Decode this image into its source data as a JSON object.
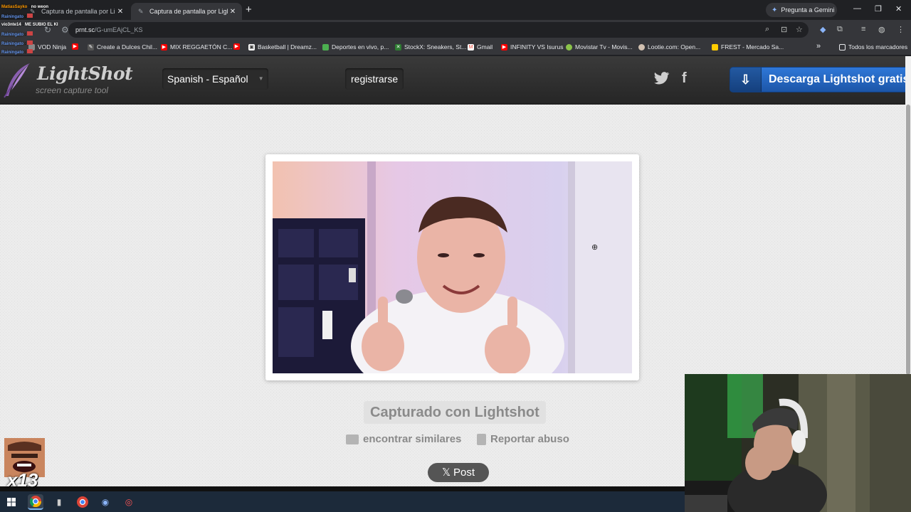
{
  "browser": {
    "tabs": [
      {
        "title": "Captura de pantalla por Lightsh",
        "active": false
      },
      {
        "title": "Captura de pantalla por Lightsh",
        "active": true
      }
    ],
    "gemini_label": "Pregunta a Gemini",
    "address": {
      "host": "prnt.sc",
      "path": "/G-umEAjCL_KS"
    },
    "bookmarks": [
      {
        "label": "VOD Ninja",
        "icon_color": "#888888"
      },
      {
        "label": "",
        "icon_color": "#ff0000"
      },
      {
        "label": "Create a Dulces Chil...",
        "icon_color": "#e8e8e8"
      },
      {
        "label": "MIX REGGAETÓN C...",
        "icon_color": "#ff0000"
      },
      {
        "label": "",
        "icon_color": "#ff0000"
      },
      {
        "label": "Basketball | Dreamz...",
        "icon_color": "#ffffff"
      },
      {
        "label": "Deportes en vivo, p...",
        "icon_color": "#4caf50"
      },
      {
        "label": "StockX: Sneakers, St...",
        "icon_color": "#2e7d32"
      },
      {
        "label": "Gmail",
        "icon_color": "#ea4335"
      },
      {
        "label": "INFINITY VS Isurus",
        "icon_color": "#ff0000"
      },
      {
        "label": "Movistar Tv - Movis...",
        "icon_color": "#8bc34a"
      },
      {
        "label": "Lootie.com: Open...",
        "icon_color": "#d0c0b0"
      },
      {
        "label": "FREST - Mercado Sa...",
        "icon_color": "#ffcc00"
      },
      {
        "label": "Todos los marcadores",
        "icon_color": "#e8eaed"
      }
    ],
    "overflow_label": "»"
  },
  "chat": [
    {
      "user": "MatiasSayko",
      "msg": "no weon",
      "color": "#ff9900"
    },
    {
      "user": "Rainingato",
      "msg": "",
      "color": "#6495ed"
    },
    {
      "user": "vio3nte14",
      "msg": "ME SUBIO EL KI",
      "color": "#ffffff"
    },
    {
      "user": "Rainingato",
      "msg": "",
      "color": "#6495ed"
    },
    {
      "user": "Rainingato",
      "msg": "",
      "color": "#6495ed"
    },
    {
      "user": "Rainingato",
      "msg": "",
      "color": "#6495ed"
    }
  ],
  "site": {
    "logo_name": "LightShot",
    "logo_tagline": "screen capture tool",
    "language": "Spanish - Español",
    "register": "registrarse",
    "social": {
      "twitter": "twitter-icon",
      "facebook": "f"
    },
    "download": "Descarga Lightshot gratis",
    "captured_with": "Capturado con Lightshot",
    "find_similar": "encontrar similares",
    "report_abuse": "Reportar abuso",
    "post": "Post"
  },
  "overlay": {
    "emote_count": "x13"
  },
  "colors": {
    "site_bg": "#ececec",
    "download_blue": "#2f78d8",
    "header_dark": "#2b2b2b"
  }
}
